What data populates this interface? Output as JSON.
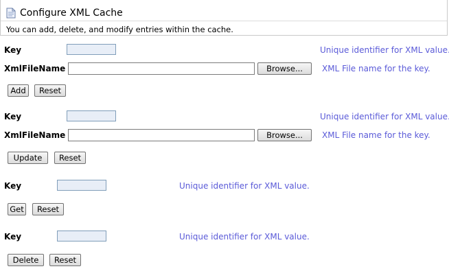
{
  "header": {
    "title": "Configure XML Cache",
    "description": "You can add, delete, and modify entries within the cache."
  },
  "add_section": {
    "key_label": "Key",
    "key_value": "",
    "key_hint": "Unique identifier for XML value.",
    "file_label": "XmlFileName",
    "file_value": "",
    "browse_label": "Browse...",
    "file_hint": "XML File name for the key.",
    "primary_button": "Add",
    "reset_button": "Reset"
  },
  "update_section": {
    "key_label": "Key",
    "key_value": "",
    "key_hint": "Unique identifier for XML value.",
    "file_label": "XmlFileName",
    "file_value": "",
    "browse_label": "Browse...",
    "file_hint": "XML File name for the key.",
    "primary_button": "Update",
    "reset_button": "Reset"
  },
  "get_section": {
    "key_label": "Key",
    "key_value": "",
    "key_hint": "Unique identifier for XML value.",
    "primary_button": "Get",
    "reset_button": "Reset"
  },
  "delete_section": {
    "key_label": "Key",
    "key_value": "",
    "key_hint": "Unique identifier for XML value.",
    "primary_button": "Delete",
    "reset_button": "Reset"
  },
  "colors": {
    "hint_text": "#5a5ad8",
    "input_background": "#e8eef7"
  }
}
